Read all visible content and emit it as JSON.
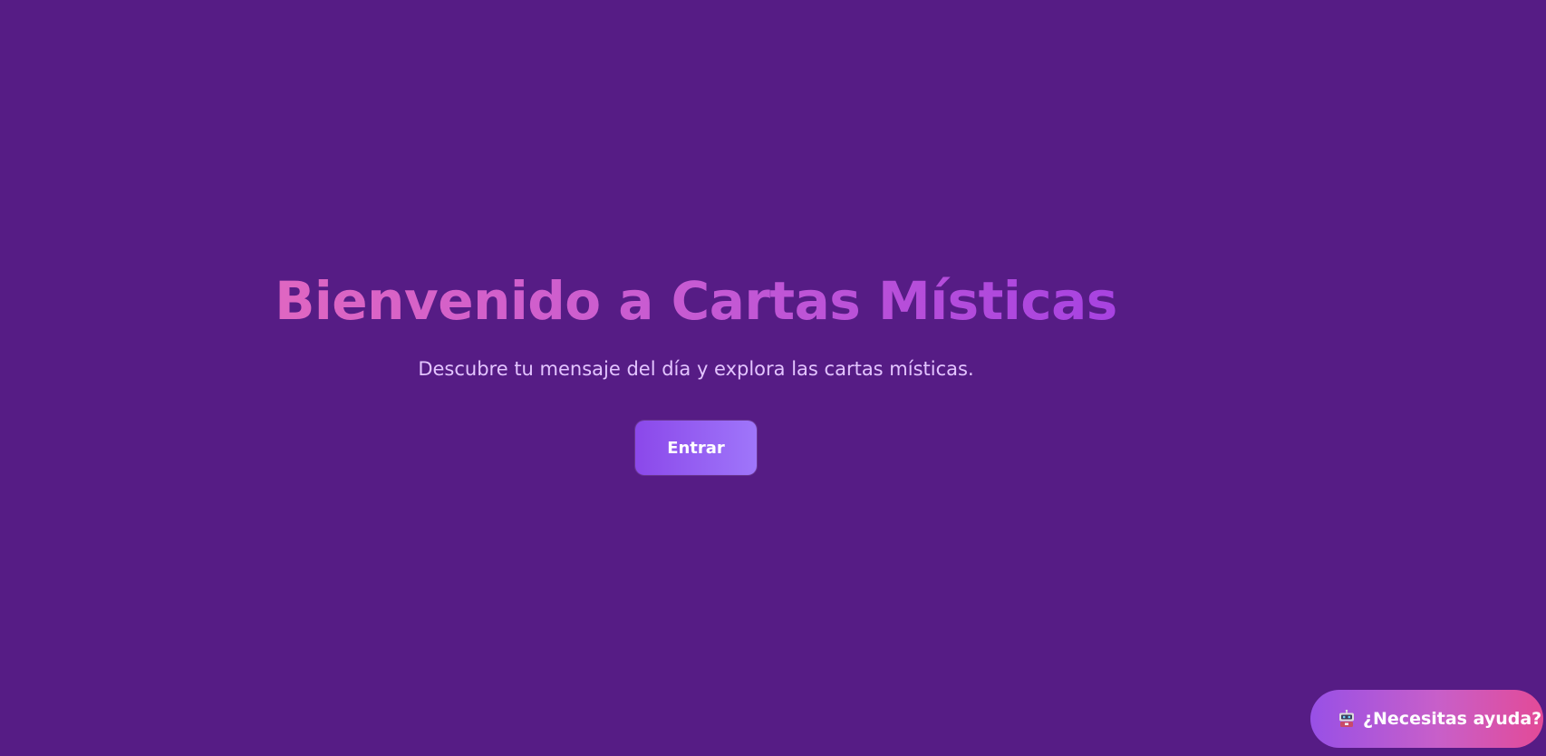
{
  "hero": {
    "title": "Bienvenido a Cartas Místicas",
    "subtitle": "Descubre tu mensaje del día y explora las cartas místicas.",
    "enter_label": "Entrar"
  },
  "help": {
    "icon": "robot-icon",
    "label": "¿Necesitas ayuda?"
  },
  "colors": {
    "background": "#561c85",
    "title_gradient_start": "#f06eb6",
    "title_gradient_end": "#9333ea",
    "subtitle": "#e3c4ff",
    "button_start": "#8b48ea",
    "button_end": "#9f76fa",
    "help_start": "#9850e6",
    "help_end": "#e34a97"
  }
}
